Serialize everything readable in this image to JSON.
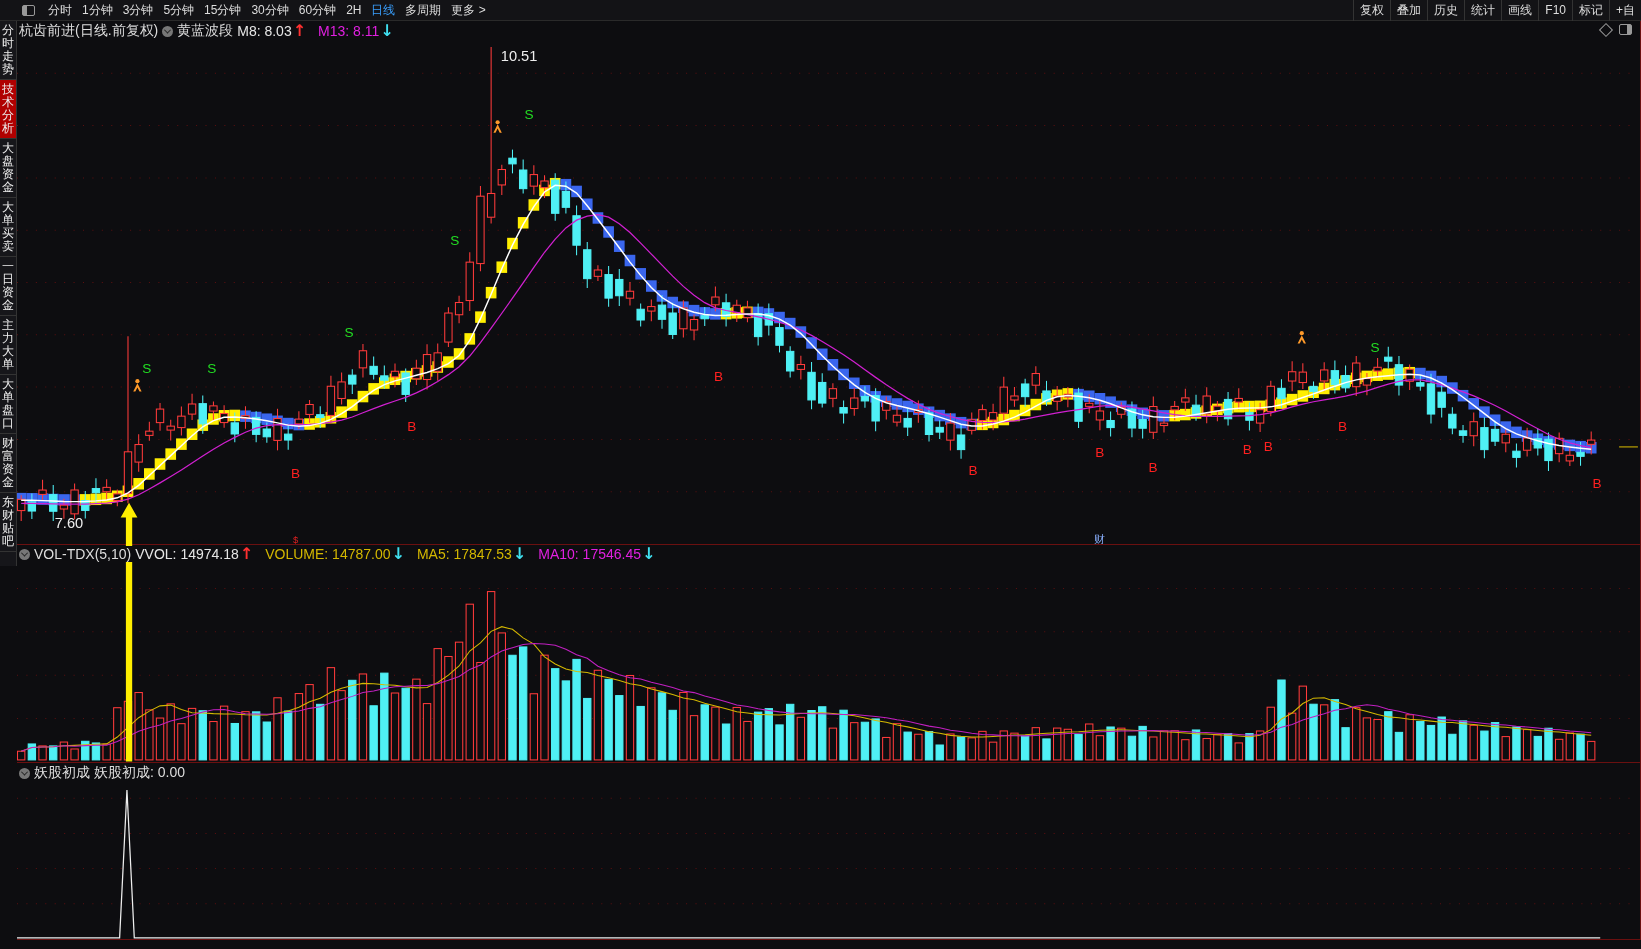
{
  "toolbar": {
    "periods": [
      {
        "label": "分时",
        "selected": false
      },
      {
        "label": "1分钟",
        "selected": false
      },
      {
        "label": "3分钟",
        "selected": false
      },
      {
        "label": "5分钟",
        "selected": false
      },
      {
        "label": "15分钟",
        "selected": false
      },
      {
        "label": "30分钟",
        "selected": false
      },
      {
        "label": "60分钟",
        "selected": false
      },
      {
        "label": "2H",
        "selected": false
      },
      {
        "label": "日线",
        "selected": true
      },
      {
        "label": "多周期",
        "selected": false
      },
      {
        "label": "更多 >",
        "selected": false
      }
    ],
    "tools": [
      "复权",
      "叠加",
      "历史",
      "统计",
      "画线",
      "F10",
      "标记",
      "+自"
    ]
  },
  "sidebar": [
    {
      "label": "分时走势",
      "selected": false
    },
    {
      "label": "技术分析",
      "selected": true
    },
    {
      "label": "大盘资金",
      "selected": false
    },
    {
      "label": "大单买卖",
      "selected": false
    },
    {
      "label": "一日资金",
      "selected": false
    },
    {
      "label": "主力大单",
      "selected": false
    },
    {
      "label": "大单盘口",
      "selected": false
    },
    {
      "label": "财富资金",
      "selected": false
    },
    {
      "label": "东财贴吧",
      "selected": false
    }
  ],
  "main_chart": {
    "title": "杭齿前进(日线.前复权)",
    "indicator": "黄蓝波段",
    "readings": [
      {
        "label": "M8: 8.03",
        "arrow": {
          "text": "↑",
          "color": "#ff3030"
        },
        "kind": "white"
      },
      {
        "label": "M13: 8.11",
        "arrow": {
          "text": "↓",
          "color": "#40e0f0"
        },
        "kind": "magenta"
      }
    ],
    "high_label": "10.51",
    "low_label": "7.60",
    "signals": [
      {
        "label": "S",
        "kind": "sell"
      },
      {
        "label": "S",
        "kind": "sell"
      },
      {
        "label": "B",
        "kind": "buy"
      },
      {
        "label": "S",
        "kind": "sell"
      },
      {
        "label": "B",
        "kind": "buy"
      },
      {
        "label": "S",
        "kind": "sell"
      },
      {
        "label": "S",
        "kind": "sell"
      },
      {
        "label": "B",
        "kind": "buy"
      },
      {
        "label": "B",
        "kind": "buy"
      },
      {
        "label": "B",
        "kind": "buy"
      },
      {
        "label": "B",
        "kind": "buy"
      },
      {
        "label": "B",
        "kind": "buy"
      },
      {
        "label": "B",
        "kind": "buy"
      },
      {
        "label": "B",
        "kind": "buy"
      },
      {
        "label": "S",
        "kind": "sell"
      },
      {
        "label": "B",
        "kind": "buy"
      }
    ],
    "markers": [
      "$",
      "财"
    ]
  },
  "volume_panel": {
    "name": "VOL-TDX(5,10)",
    "readings": [
      {
        "label": "VVOL: 14974.18",
        "arrow": {
          "text": "↑",
          "color": "#ff3030"
        },
        "kind": "white"
      },
      {
        "label": "VOLUME: 14787.00",
        "arrow": {
          "text": "↓",
          "color": "#40e0f0"
        },
        "kind": "yellow"
      },
      {
        "label": "MA5: 17847.53",
        "arrow": {
          "text": "↓",
          "color": "#40e0f0"
        },
        "kind": "yellow"
      },
      {
        "label": "MA10: 17546.45",
        "arrow": {
          "text": "↓",
          "color": "#40e0f0"
        },
        "kind": "magenta"
      }
    ]
  },
  "indicator_panel": {
    "name": "妖股初成",
    "reading": "妖股初成: 0.00"
  }
}
